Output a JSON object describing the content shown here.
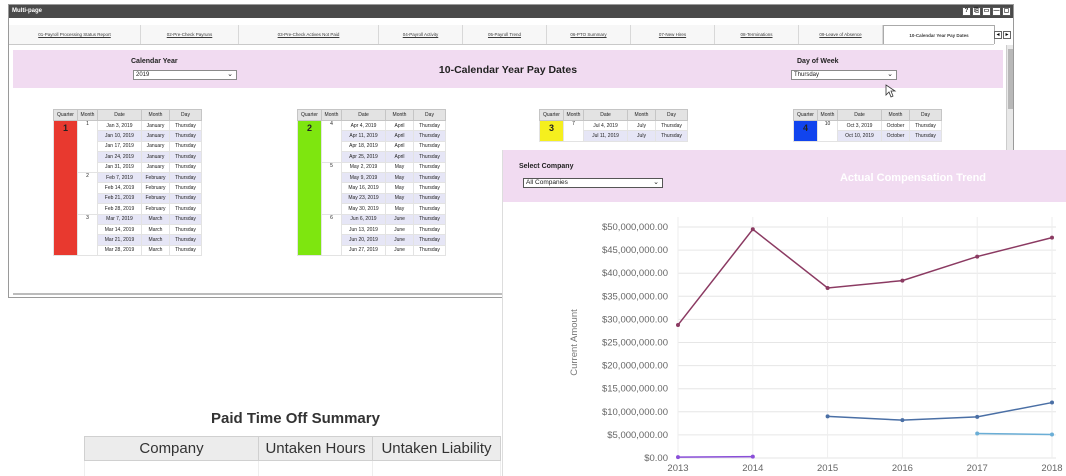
{
  "window": {
    "title": "Multi-page",
    "controls": [
      "?",
      "⎘",
      "▭",
      "—",
      "▢"
    ]
  },
  "tabs": [
    {
      "label": "01-Payroll Processing Status Report",
      "active": false
    },
    {
      "label": "02-Pre-Check Payruns",
      "active": false
    },
    {
      "label": "03-Pre-Check Actives Not Paid",
      "active": false
    },
    {
      "label": "04-Payroll Activity",
      "active": false
    },
    {
      "label": "05-Payroll Trend",
      "active": false
    },
    {
      "label": "06-PTO Summary",
      "active": false
    },
    {
      "label": "07-New Hires",
      "active": false
    },
    {
      "label": "08-Terminations",
      "active": false
    },
    {
      "label": "09-Leave of Absence",
      "active": false
    },
    {
      "label": "10-Calendar Year Pay Dates",
      "active": true
    }
  ],
  "tabnav": {
    "prev": "◂",
    "next": "▸",
    "up": "^"
  },
  "header": {
    "calendar_year_label": "Calendar Year",
    "calendar_year_value": "2019",
    "page_title": "10-Calendar Year Pay Dates",
    "day_of_week_label": "Day of Week",
    "day_of_week_value": "Thursday",
    "caret": "⌄"
  },
  "columns": [
    "Quarter",
    "Month",
    "Date",
    "Month",
    "Day"
  ],
  "quarters": [
    {
      "quarter": "1",
      "color": "#e8392f",
      "months": [
        {
          "month": "1",
          "rows": [
            {
              "date": "Jan 3, 2019",
              "month_name": "January",
              "day": "Thursday"
            },
            {
              "date": "Jan 10, 2019",
              "month_name": "January",
              "day": "Thursday"
            },
            {
              "date": "Jan 17, 2019",
              "month_name": "January",
              "day": "Thursday"
            },
            {
              "date": "Jan 24, 2019",
              "month_name": "January",
              "day": "Thursday"
            },
            {
              "date": "Jan 31, 2019",
              "month_name": "January",
              "day": "Thursday"
            }
          ]
        },
        {
          "month": "2",
          "rows": [
            {
              "date": "Feb 7, 2019",
              "month_name": "February",
              "day": "Thursday"
            },
            {
              "date": "Feb 14, 2019",
              "month_name": "February",
              "day": "Thursday"
            },
            {
              "date": "Feb 21, 2019",
              "month_name": "February",
              "day": "Thursday"
            },
            {
              "date": "Feb 28, 2019",
              "month_name": "February",
              "day": "Thursday"
            }
          ]
        },
        {
          "month": "3",
          "rows": [
            {
              "date": "Mar 7, 2019",
              "month_name": "March",
              "day": "Thursday"
            },
            {
              "date": "Mar 14, 2019",
              "month_name": "March",
              "day": "Thursday"
            },
            {
              "date": "Mar 21, 2019",
              "month_name": "March",
              "day": "Thursday"
            },
            {
              "date": "Mar 28, 2019",
              "month_name": "March",
              "day": "Thursday"
            }
          ]
        }
      ]
    },
    {
      "quarter": "2",
      "color": "#7ee60f",
      "months": [
        {
          "month": "4",
          "rows": [
            {
              "date": "Apr 4, 2019",
              "month_name": "April",
              "day": "Thursday"
            },
            {
              "date": "Apr 11, 2019",
              "month_name": "April",
              "day": "Thursday"
            },
            {
              "date": "Apr 18, 2019",
              "month_name": "April",
              "day": "Thursday"
            },
            {
              "date": "Apr 25, 2019",
              "month_name": "April",
              "day": "Thursday"
            }
          ]
        },
        {
          "month": "5",
          "rows": [
            {
              "date": "May 2, 2019",
              "month_name": "May",
              "day": "Thursday"
            },
            {
              "date": "May 9, 2019",
              "month_name": "May",
              "day": "Thursday"
            },
            {
              "date": "May 16, 2019",
              "month_name": "May",
              "day": "Thursday"
            },
            {
              "date": "May 23, 2019",
              "month_name": "May",
              "day": "Thursday"
            },
            {
              "date": "May 30, 2019",
              "month_name": "May",
              "day": "Thursday"
            }
          ]
        },
        {
          "month": "6",
          "rows": [
            {
              "date": "Jun 6, 2019",
              "month_name": "June",
              "day": "Thursday"
            },
            {
              "date": "Jun 13, 2019",
              "month_name": "June",
              "day": "Thursday"
            },
            {
              "date": "Jun 20, 2019",
              "month_name": "June",
              "day": "Thursday"
            },
            {
              "date": "Jun 27, 2019",
              "month_name": "June",
              "day": "Thursday"
            }
          ]
        }
      ]
    },
    {
      "quarter": "3",
      "color": "#f5ef1e",
      "months": [
        {
          "month": "7",
          "rows": [
            {
              "date": "Jul 4, 2019",
              "month_name": "July",
              "day": "Thursday"
            },
            {
              "date": "Jul 11, 2019",
              "month_name": "July",
              "day": "Thursday"
            }
          ]
        }
      ]
    },
    {
      "quarter": "4",
      "color": "#1144ee",
      "months": [
        {
          "month": "10",
          "rows": [
            {
              "date": "Oct 3, 2019",
              "month_name": "October",
              "day": "Thursday"
            },
            {
              "date": "Oct 10, 2019",
              "month_name": "October",
              "day": "Thursday"
            }
          ]
        }
      ]
    }
  ],
  "pto": {
    "title": "Paid Time Off Summary",
    "columns": [
      "Company",
      "Untaken Hours",
      "Untaken Liability"
    ]
  },
  "compensation": {
    "select_label": "Select Company",
    "select_value": "All Companies",
    "title": "Actual Compensation Trend"
  },
  "chart_data": {
    "type": "line",
    "title": "Actual Compensation Trend",
    "xlabel": "",
    "ylabel": "Current Amount",
    "x": [
      "2013",
      "2014",
      "2015",
      "2016",
      "2017",
      "2018"
    ],
    "ylim": [
      0,
      50000000
    ],
    "yticks": [
      "$0.00",
      "$5,000,000.00",
      "$10,000,000.00",
      "$15,000,000.00",
      "$20,000,000.00",
      "$25,000,000.00",
      "$30,000,000.00",
      "$35,000,000.00",
      "$40,000,000.00",
      "$45,000,000.00",
      "$50,000,000.00"
    ],
    "grid": true,
    "series": [
      {
        "color": "#8b3a62",
        "values": [
          28800000,
          49500000,
          36800000,
          38400000,
          43600000,
          47700000
        ]
      },
      {
        "color": "#4a6fa5",
        "values": [
          null,
          null,
          9000000,
          8200000,
          8900000,
          12000000
        ]
      },
      {
        "color": "#6aaed6",
        "values": [
          null,
          null,
          null,
          null,
          5300000,
          5100000
        ]
      },
      {
        "color": "#8a4fd8",
        "values": [
          200000,
          300000,
          null,
          null,
          null,
          null
        ]
      }
    ]
  }
}
